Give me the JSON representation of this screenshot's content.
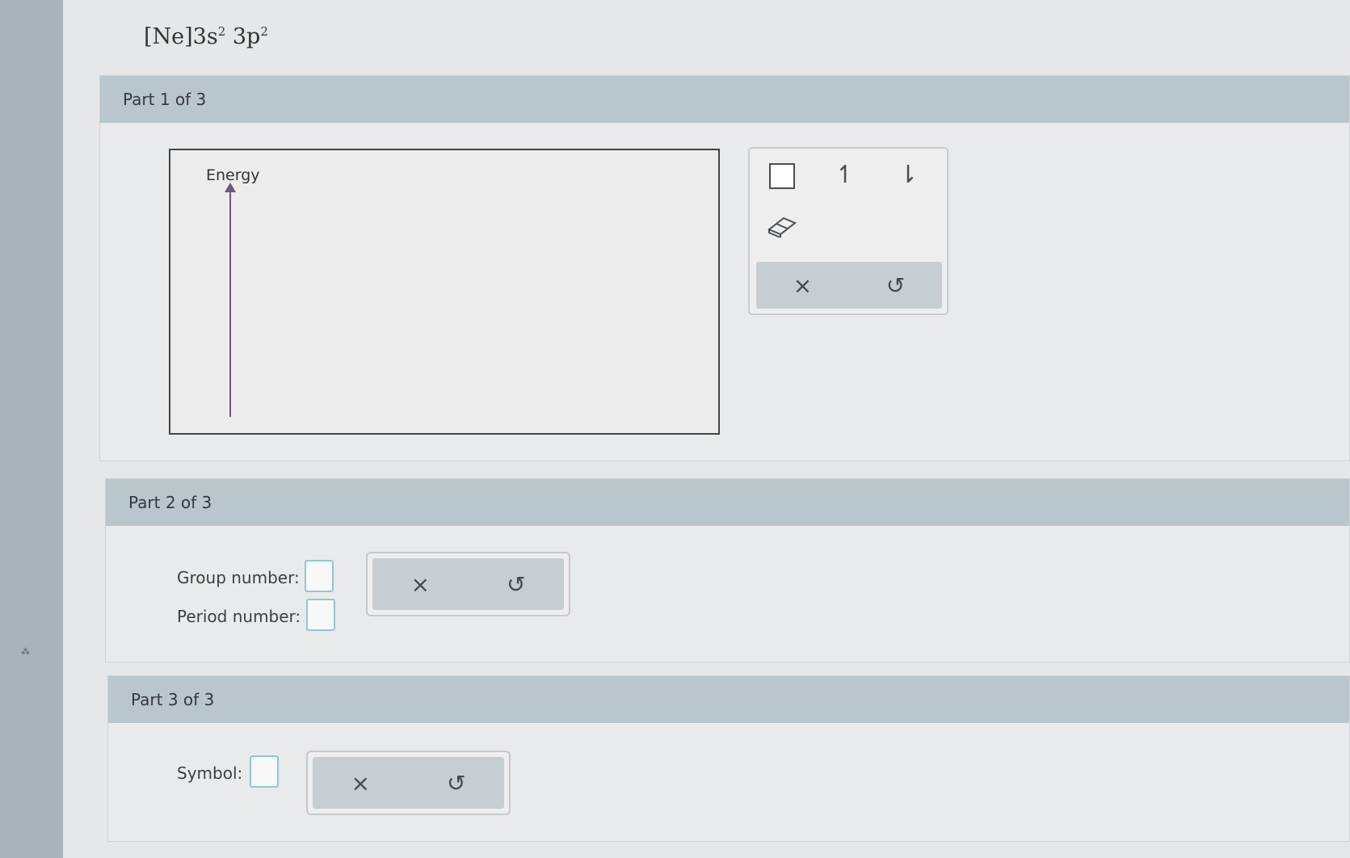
{
  "config": {
    "base": "[Ne]3s",
    "sup1": "2",
    "mid": "3p",
    "sup2": "2"
  },
  "part1": {
    "title": "Part 1 of 3",
    "diagram": {
      "energy_label": "Energy"
    },
    "palette": {
      "tools": [
        {
          "name": "orbital-box-icon",
          "glyph": ""
        },
        {
          "name": "up-arrow-icon",
          "glyph": "↿"
        },
        {
          "name": "down-arrow-icon",
          "glyph": "⇂"
        },
        {
          "name": "eraser-icon",
          "glyph": "⌫"
        }
      ],
      "clear": "×",
      "undo": "↺"
    }
  },
  "part2": {
    "title": "Part 2 of 3",
    "group_label": "Group number:",
    "period_label": "Period number:",
    "clear": "×",
    "undo": "↺"
  },
  "part3": {
    "title": "Part 3 of 3",
    "symbol_label": "Symbol:",
    "clear": "×",
    "undo": "↺"
  },
  "colors": {
    "header": "#b9c6cc",
    "input_border": "#8fc7d6",
    "rail": "#a8b4ba"
  }
}
